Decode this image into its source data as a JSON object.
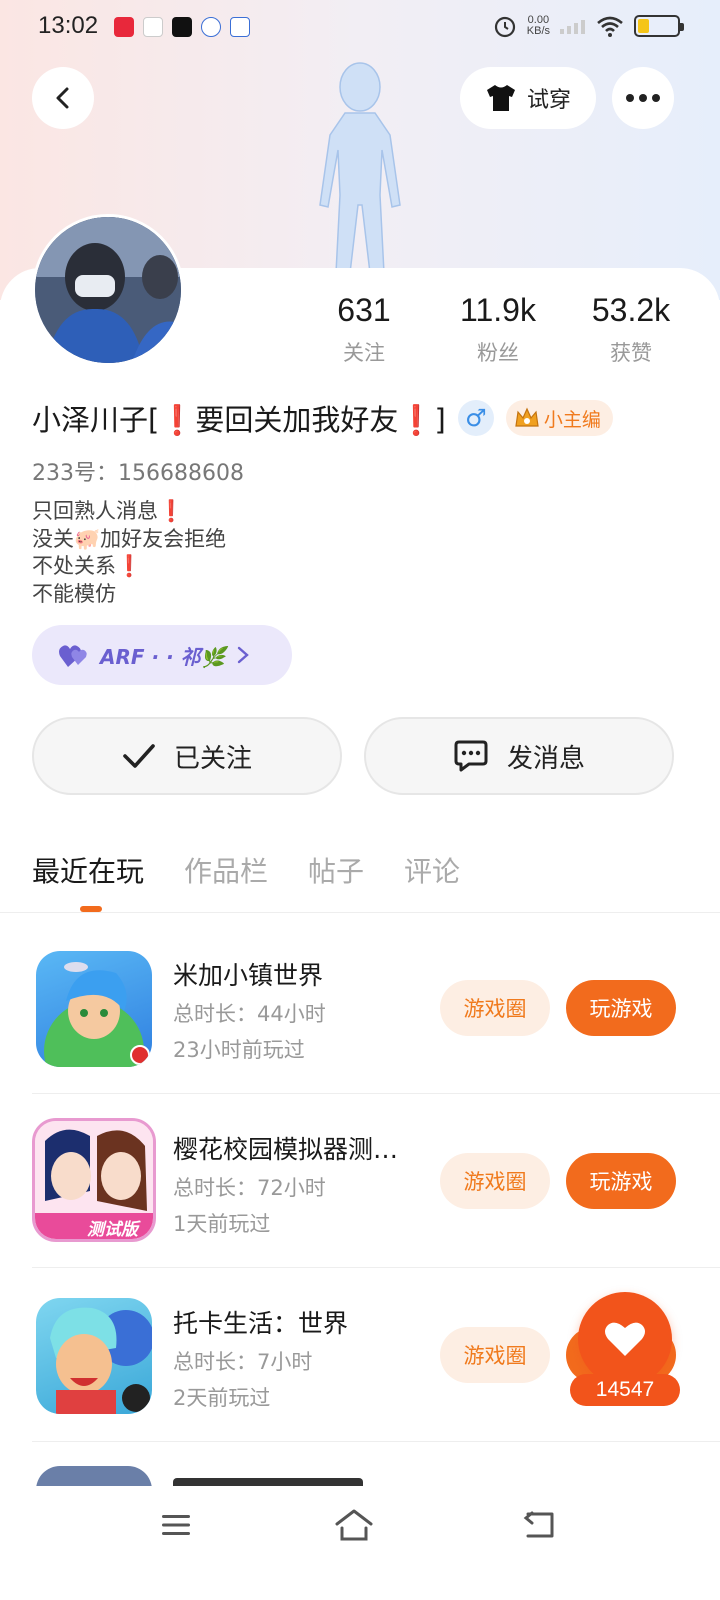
{
  "status_bar": {
    "time": "13:02",
    "net_speed": "0.00",
    "net_unit": "KB/s",
    "battery_level": 0.3
  },
  "header": {
    "tryon_label": "试穿"
  },
  "profile": {
    "stats": [
      {
        "value": "631",
        "label": "关注"
      },
      {
        "value": "11.9k",
        "label": "粉丝"
      },
      {
        "value": "53.2k",
        "label": "获赞"
      }
    ],
    "name": "小泽川子[❗要回关加我好友❗]",
    "gender_symbol": "♂",
    "badge": "小主编",
    "uid": "233号：156688608",
    "bio": [
      "只回熟人消息❗",
      "没关🐖加好友会拒绝",
      "不处关系❗",
      "不能模仿"
    ],
    "guild_label": "ARF · · 祁🌿",
    "follow_label": "已关注",
    "message_label": "发消息"
  },
  "tabs": [
    "最近在玩",
    "作品栏",
    "帖子",
    "评论"
  ],
  "games": [
    {
      "title": "米加小镇世界",
      "duration": "总时长：44小时",
      "last_played": "23小时前玩过",
      "circle_label": "游戏圈",
      "play_label": "玩游戏"
    },
    {
      "title": "樱花校园模拟器测…",
      "duration": "总时长：72小时",
      "last_played": "1天前玩过",
      "circle_label": "游戏圈",
      "play_label": "玩游戏",
      "icon_tag": "测试版"
    },
    {
      "title": "托卡生活：世界",
      "duration": "总时长：7小时",
      "last_played": "2天前玩过",
      "circle_label": "游戏圈"
    }
  ],
  "like": {
    "count": "14547"
  },
  "colors": {
    "accent": "#f26b1d",
    "accent_light": "#fdeee3",
    "guild": "#6a5fd0"
  }
}
